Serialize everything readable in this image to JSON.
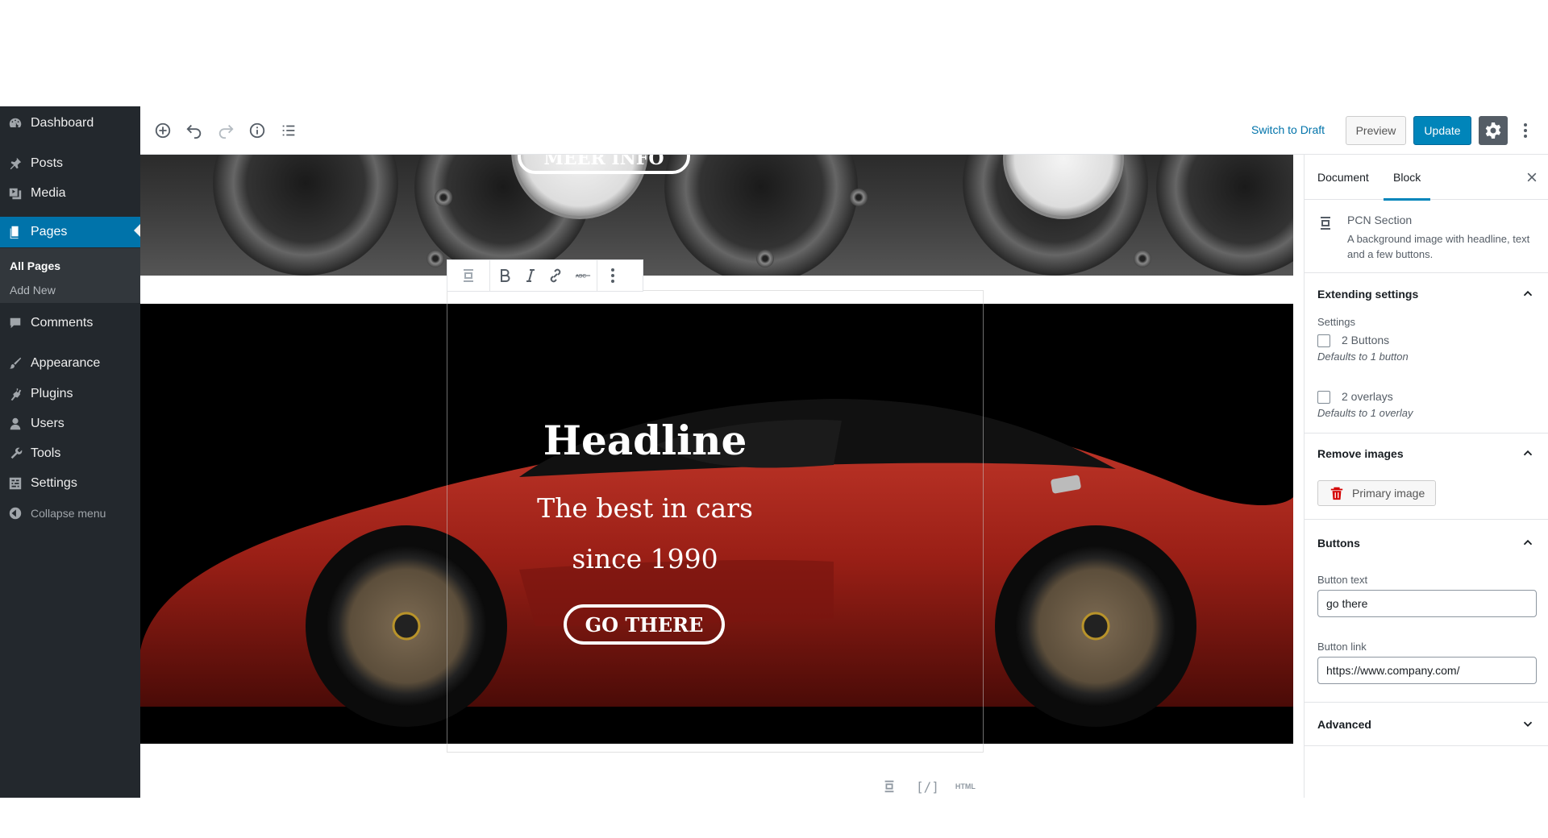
{
  "sidebar": {
    "items": [
      {
        "label": "Dashboard",
        "icon": "dashboard-icon"
      },
      {
        "label": "Posts",
        "icon": "pin-icon"
      },
      {
        "label": "Media",
        "icon": "media-icon"
      },
      {
        "label": "Pages",
        "icon": "page-icon"
      },
      {
        "label": "Comments",
        "icon": "comment-icon"
      },
      {
        "label": "Appearance",
        "icon": "brush-icon"
      },
      {
        "label": "Plugins",
        "icon": "plugin-icon"
      },
      {
        "label": "Users",
        "icon": "user-icon"
      },
      {
        "label": "Tools",
        "icon": "wrench-icon"
      },
      {
        "label": "Settings",
        "icon": "settings-icon"
      }
    ],
    "submenu": {
      "all_pages": "All Pages",
      "add_new": "Add New"
    },
    "collapse": "Collapse menu"
  },
  "toolbar": {
    "switch_to_draft": "Switch to Draft",
    "preview": "Preview",
    "update": "Update"
  },
  "canvas": {
    "top_button": "MEER INFO",
    "headline": "Headline",
    "text_line1": "The best in cars",
    "text_line2": "since 1990",
    "button": "GO THERE",
    "html_label": "HTML",
    "shortcode_label": "[/]"
  },
  "panel": {
    "tabs": [
      "Document",
      "Block"
    ],
    "active_tab": "Block",
    "block": {
      "title": "PCN Section",
      "description": "A background image with headline, text and a few buttons."
    },
    "extending": {
      "title": "Extending settings",
      "settings_label": "Settings",
      "opt1_label": "2 Buttons",
      "opt1_help": "Defaults to 1 button",
      "opt2_label": "2 overlays",
      "opt2_help": "Defaults to 1 overlay"
    },
    "remove_images": {
      "title": "Remove images",
      "primary_image": "Primary image"
    },
    "buttons": {
      "title": "Buttons",
      "text_label": "Button text",
      "text_value": "go there",
      "link_label": "Button link",
      "link_value": "https://www.company.com/"
    },
    "advanced": {
      "title": "Advanced"
    }
  },
  "colors": {
    "sidebar_bg": "#23282d",
    "accent": "#0073aa",
    "update_bg": "#0085ba",
    "car_red": "#a4231a"
  }
}
